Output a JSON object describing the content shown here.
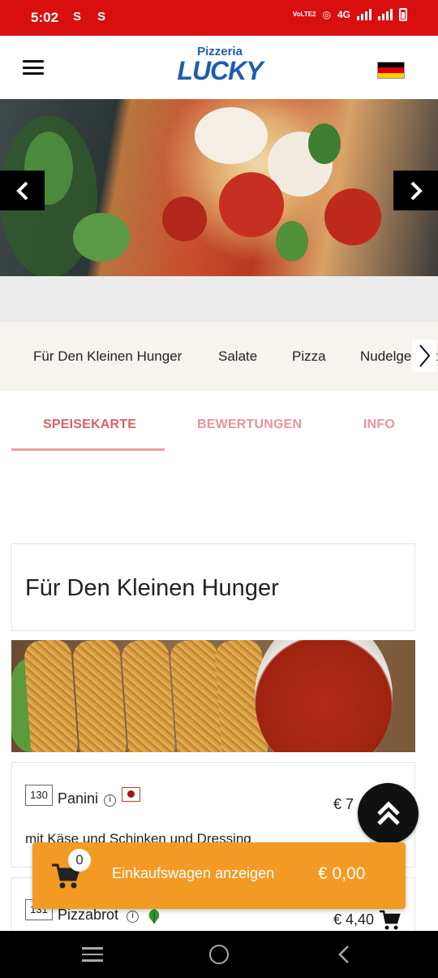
{
  "status_bar": {
    "time": "5:02",
    "left_icons": "S S",
    "volte": "VoLTE2",
    "network": "4G"
  },
  "header": {
    "menu_icon": "hamburger-icon",
    "logo_line1": "Pizzeria",
    "logo_line2": "LUCKY",
    "language_flag": "german-flag-icon",
    "flag_colors": [
      "#000000",
      "#dd0000",
      "#ffce00"
    ]
  },
  "hero": {
    "prev_icon": "chevron-left-icon",
    "next_icon": "chevron-right-icon"
  },
  "categories": {
    "items": [
      "Für Den Kleinen Hunger",
      "Salate",
      "Pizza",
      "Nudelgerichte"
    ],
    "more_icon": "chevron-right-icon"
  },
  "tabs": {
    "items": [
      "SPEISEKARTE",
      "BEWERTUNGEN",
      "INFO"
    ],
    "active": "SPEISEKARTE",
    "accent_color": "#d9606a"
  },
  "section": {
    "title": "Für Den Kleinen Hunger"
  },
  "items": [
    {
      "number": "130",
      "name": "Panini",
      "price": "€ 7",
      "description": "mit Käse und Schinken und Dressing",
      "badge": "pork-badge-icon"
    },
    {
      "number": "131",
      "name": "Pizzabrot",
      "price": "€ 4,40",
      "badge": "vegetarian-leaf-icon"
    }
  ],
  "cart": {
    "count": "0",
    "label": "Einkaufswagen anzeigen",
    "total": "€ 0,00",
    "color": "#f39a24"
  },
  "nav": {
    "recents_icon": "recents-icon",
    "home_icon": "home-icon",
    "back_icon": "back-icon"
  }
}
